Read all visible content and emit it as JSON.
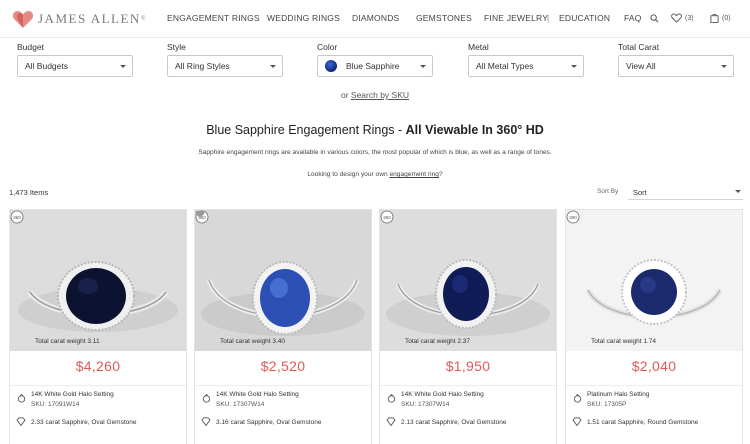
{
  "brand": {
    "name": "JAMES ALLEN",
    "reg": "®",
    "accent": "#e05a5a"
  },
  "nav": {
    "items": [
      "ENGAGEMENT RINGS",
      "WEDDING RINGS",
      "DIAMONDS",
      "GEMSTONES",
      "FINE JEWELRY",
      "EDUCATION",
      "FAQ"
    ],
    "separator": "|",
    "wishlist_count": "(3)",
    "cart_count": "(0)"
  },
  "filters": [
    {
      "label": "Budget",
      "value": "All Budgets"
    },
    {
      "label": "Style",
      "value": "All Ring Styles"
    },
    {
      "label": "Color",
      "value": "Blue Sapphire",
      "swatch": "#1c3a9a"
    },
    {
      "label": "Metal",
      "value": "All Metal Types"
    },
    {
      "label": "Total Carat",
      "value": "View All"
    }
  ],
  "sku_search": {
    "prefix": "or",
    "link": "Search by SKU"
  },
  "title": {
    "main": "Blue Sapphire Engagement Rings - ",
    "bold": "All Viewable In 360° HD"
  },
  "description": "Sapphire engagement rings are available in various colors, the most popular of which is blue, as well as a range of tones.",
  "design_line": {
    "prefix": "Looking to design your own ",
    "link": "engagement ring",
    "suffix": "?"
  },
  "items_count": "1,473 Items",
  "sort": {
    "label": "Sort By",
    "value": "Sort"
  },
  "products": [
    {
      "weight": "Total carat weight 3.11",
      "price": "$4,260",
      "setting": "14K White Gold Halo Setting",
      "sku": "SKU: 17091W14",
      "gem": "2.33 carat Sapphire, Oval Gemstone",
      "icon": "ring-icon"
    },
    {
      "weight": "Total carat weight 3.40",
      "price": "$2,520",
      "setting": "14K White Gold Halo Setting",
      "sku": "SKU: 17307W14",
      "gem": "3.16 carat Sapphire, Oval Gemstone",
      "icon": "ring-icon"
    },
    {
      "weight": "Total carat weight 2.37",
      "price": "$1,950",
      "setting": "14K White Gold Halo Setting",
      "sku": "SKU: 17307W14",
      "gem": "2.13 carat Sapphire, Oval Gemstone",
      "icon": "ring-icon"
    },
    {
      "weight": "Total carat weight 1.74",
      "price": "$2,040",
      "setting": "Platinum Halo Setting",
      "sku": "SKU: 17305P",
      "gem": "1.51 carat Sapphire, Round Gemstone",
      "icon": "ring-icon"
    }
  ]
}
